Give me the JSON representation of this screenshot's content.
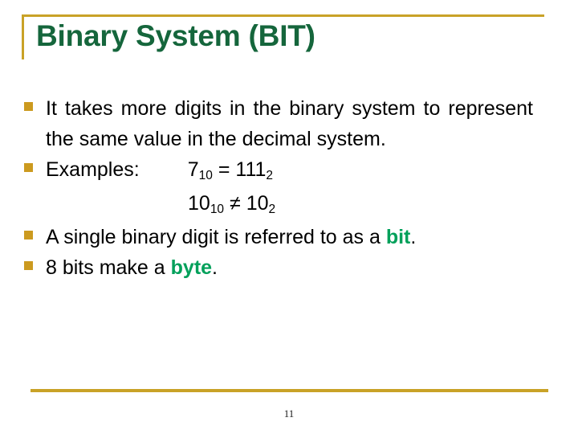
{
  "slide": {
    "title": "Binary System (BIT)",
    "accent_gold": "#c9a227",
    "title_green": "#15663c",
    "keyword_green": "#00a05a",
    "bullet_marker_color": "#cc9a1f",
    "page_number": "11"
  },
  "bullets": [
    {
      "text": "It takes more digits in the binary system to represent the same value in the decimal system."
    },
    {
      "label": "Examples:",
      "example_1": {
        "value": "7",
        "value_sub": "10",
        "operator": "=",
        "result": "111",
        "result_sub": "2"
      },
      "example_2": {
        "value": "10",
        "value_sub": "10",
        "operator": "≠",
        "result": "10",
        "result_sub": "2"
      }
    },
    {
      "prefix": "A single binary digit is referred to as a ",
      "keyword": "bit",
      "suffix": "."
    },
    {
      "prefix": "8 bits make a ",
      "keyword": "byte",
      "suffix": "."
    }
  ]
}
